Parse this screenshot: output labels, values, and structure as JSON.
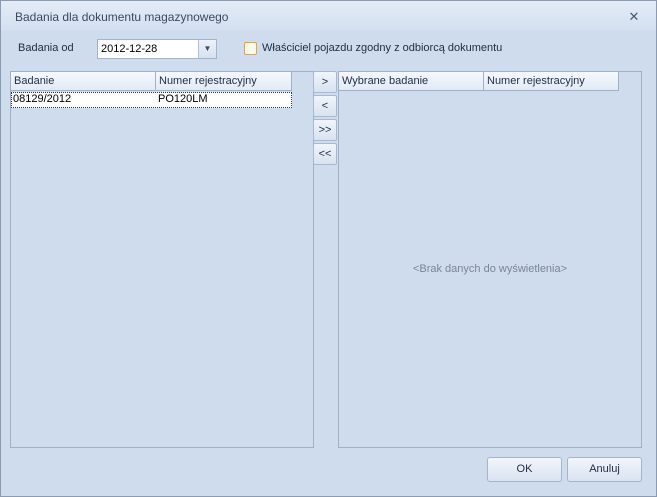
{
  "window": {
    "title": "Badania dla dokumentu magazynowego"
  },
  "filter": {
    "date_label": "Badania od",
    "date_value": "2012-12-28",
    "owner_checkbox_label": "Właściciel pojazdu zgodny z odbiorcą dokumentu",
    "owner_checkbox_checked": false
  },
  "left_grid": {
    "columns": [
      "Badanie",
      "Numer rejestracyjny"
    ],
    "rows": [
      {
        "badanie": "08129/2012",
        "numer": "PO120LM"
      }
    ]
  },
  "transfer_buttons": {
    "add": ">",
    "remove": "<",
    "add_all": ">>",
    "remove_all": "<<"
  },
  "right_grid": {
    "columns": [
      "Wybrane badanie",
      "Numer rejestracyjny"
    ],
    "empty_text": "<Brak danych do wyświetlenia>"
  },
  "footer": {
    "ok_label": "OK",
    "cancel_label": "Anuluj"
  },
  "icons": {
    "close": "close-icon",
    "dropdown": "chevron-down-icon"
  },
  "colors": {
    "window_bg": "#cfdcee",
    "checkbox_border": "#e6a43a"
  }
}
